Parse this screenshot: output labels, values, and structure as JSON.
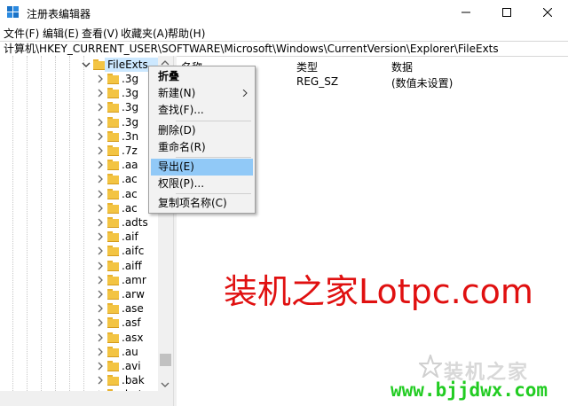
{
  "window": {
    "title": "注册表编辑器",
    "minimize_icon": "minimize-icon",
    "maximize_icon": "maximize-icon",
    "close_icon": "close-icon"
  },
  "menubar": {
    "items": [
      "文件(F)",
      "编辑(E)",
      "查看(V)",
      "收藏夹(A)",
      "帮助(H)"
    ]
  },
  "address": "计算机\\HKEY_CURRENT_USER\\SOFTWARE\\Microsoft\\Windows\\CurrentVersion\\Explorer\\FileExts",
  "tree": {
    "selected": "FileExts",
    "items": [
      ".3g",
      ".3g",
      ".3g",
      ".3g",
      ".3n",
      ".7z",
      ".aa",
      ".ac",
      ".ac",
      ".ac",
      ".adts",
      ".aif",
      ".aifc",
      ".aiff",
      ".amr",
      ".arw",
      ".ase",
      ".asf",
      ".asx",
      ".au",
      ".avi",
      ".bak",
      ".bat"
    ]
  },
  "list": {
    "columns": [
      "名称",
      "类型",
      "数据"
    ],
    "rows": [
      {
        "name": "",
        "type": "REG_SZ",
        "data": "(数值未设置)"
      }
    ]
  },
  "context_menu": {
    "items": [
      {
        "label": "折叠",
        "bold": true
      },
      {
        "label": "新建(N)",
        "submenu": true
      },
      {
        "label": "查找(F)..."
      },
      {
        "label": "删除(D)"
      },
      {
        "label": "重命名(R)"
      },
      {
        "label": "导出(E)",
        "highlighted": true
      },
      {
        "label": "权限(P)..."
      },
      {
        "label": "复制项名称(C)"
      }
    ]
  },
  "watermark": {
    "text": "装机之家Lotpc.com",
    "logo_text": "装机之家",
    "url": "www.bjjdwx.com"
  },
  "colors": {
    "selection": "#cce8ff",
    "menu_highlight": "#91c9f7",
    "watermark_red": "#e01010",
    "watermark_green": "#22cc22"
  }
}
